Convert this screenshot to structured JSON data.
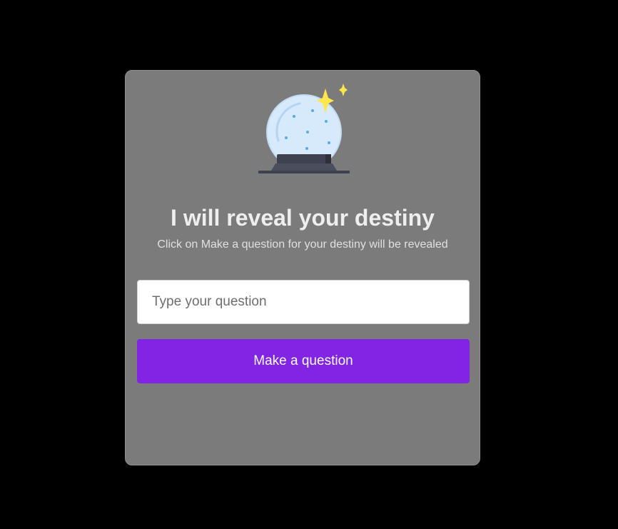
{
  "card": {
    "icon": "crystal-ball-icon",
    "title": "I will reveal your destiny",
    "subtitle": "Click on Make a question for your destiny will be revealed"
  },
  "form": {
    "question_placeholder": "Type your question",
    "question_value": "",
    "submit_label": "Make a question"
  },
  "colors": {
    "background": "#000000",
    "card": "#7b7b7b",
    "accent": "#8224e3",
    "sparkle": "#fde74c",
    "ball": "#d6eafc"
  }
}
